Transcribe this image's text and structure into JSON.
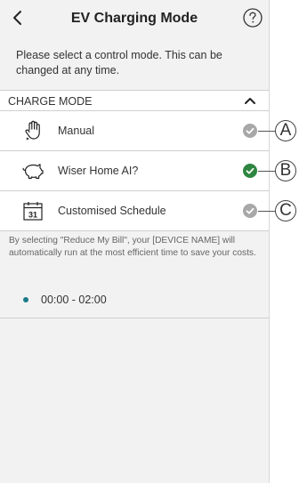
{
  "header": {
    "title": "EV Charging Mode",
    "back_icon": "chevron-left-icon",
    "help_icon": "question-circle-icon"
  },
  "intro_text": "Please select a control mode. This can be changed at any time.",
  "section": {
    "label": "CHARGE MODE",
    "toggle_icon": "chevron-up-icon",
    "expanded": true
  },
  "modes": [
    {
      "label": "Manual",
      "icon": "hand-icon",
      "selected": false,
      "callout": "A"
    },
    {
      "label": "Wiser Home AI?",
      "icon": "piggy-bank-icon",
      "selected": true,
      "callout": "B"
    },
    {
      "label": "Customised Schedule",
      "icon": "calendar-icon",
      "calendar_day": "31",
      "selected": false,
      "callout": "C"
    }
  ],
  "description": "By selecting \"Reduce My Bill\", your [DEVICE NAME] will automatically run at the most efficient time to save your costs.",
  "time_slots": [
    {
      "label": "00:00 - 02:00"
    }
  ],
  "colors": {
    "selected_check": "#2e8540",
    "unselected_check": "#a8a8a8",
    "time_dot": "#1a7a8a",
    "background": "#f2f2f2"
  }
}
